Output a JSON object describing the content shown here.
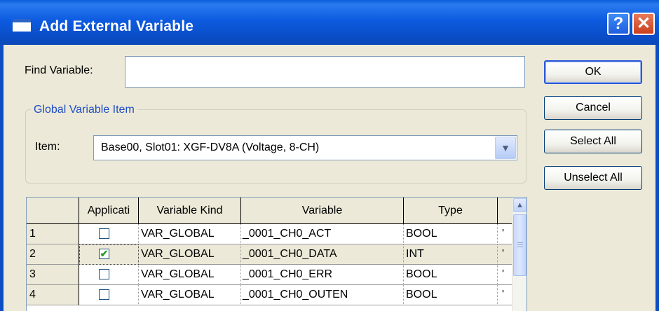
{
  "dialog": {
    "title": "Add External Variable",
    "help_label": "?",
    "close_label": "✕"
  },
  "find": {
    "label": "Find Variable:",
    "value": ""
  },
  "buttons": {
    "ok": "OK",
    "cancel": "Cancel",
    "select_all": "Select All",
    "unselect_all": "Unselect All"
  },
  "global_group": {
    "legend": "Global Variable Item",
    "item_label": "Item:",
    "item_value": "Base00, Slot01: XGF-DV8A (Voltage, 8-CH)"
  },
  "table": {
    "headers": [
      "",
      "Applicati",
      "Variable Kind",
      "Variable",
      "Type"
    ],
    "rows": [
      {
        "num": "1",
        "checked": false,
        "kind": "VAR_GLOBAL",
        "variable": "_0001_CH0_ACT",
        "type": "BOOL",
        "extra": "'"
      },
      {
        "num": "2",
        "checked": true,
        "kind": "VAR_GLOBAL",
        "variable": "_0001_CH0_DATA",
        "type": "INT",
        "extra": "'"
      },
      {
        "num": "3",
        "checked": false,
        "kind": "VAR_GLOBAL",
        "variable": "_0001_CH0_ERR",
        "type": "BOOL",
        "extra": "'"
      },
      {
        "num": "4",
        "checked": false,
        "kind": "VAR_GLOBAL",
        "variable": "_0001_CH0_OUTEN",
        "type": "BOOL",
        "extra": "'"
      }
    ]
  },
  "colors": {
    "titlebar": "#0a4ec8",
    "dialog_bg": "#ece9d8",
    "group_legend": "#1e4dc3",
    "check_mark": "#21a121"
  }
}
